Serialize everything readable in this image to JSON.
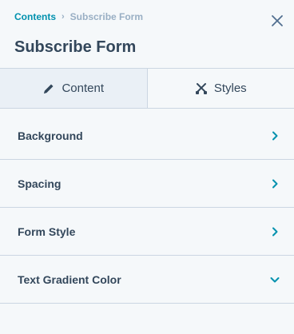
{
  "breadcrumb": {
    "parent": "Contents",
    "separator": "›",
    "current": "Subscribe Form"
  },
  "header": {
    "title": "Subscribe Form"
  },
  "tabs": [
    {
      "label": "Content",
      "icon": "pencil-icon",
      "active": false
    },
    {
      "label": "Styles",
      "icon": "crossed-brushes-icon",
      "active": true
    }
  ],
  "sections": [
    {
      "label": "Background",
      "icon": "chevron-right-icon",
      "expanded": false
    },
    {
      "label": "Spacing",
      "icon": "chevron-right-icon",
      "expanded": false
    },
    {
      "label": "Form Style",
      "icon": "chevron-right-icon",
      "expanded": false
    },
    {
      "label": "Text Gradient Color",
      "icon": "chevron-down-icon",
      "expanded": true
    }
  ],
  "colors": {
    "accent": "#0091ae",
    "text": "#33475b",
    "muted": "#99afc4",
    "border": "#cbd6e2",
    "background": "#f5f8fa",
    "inactive_tab": "#eaf0f6"
  }
}
